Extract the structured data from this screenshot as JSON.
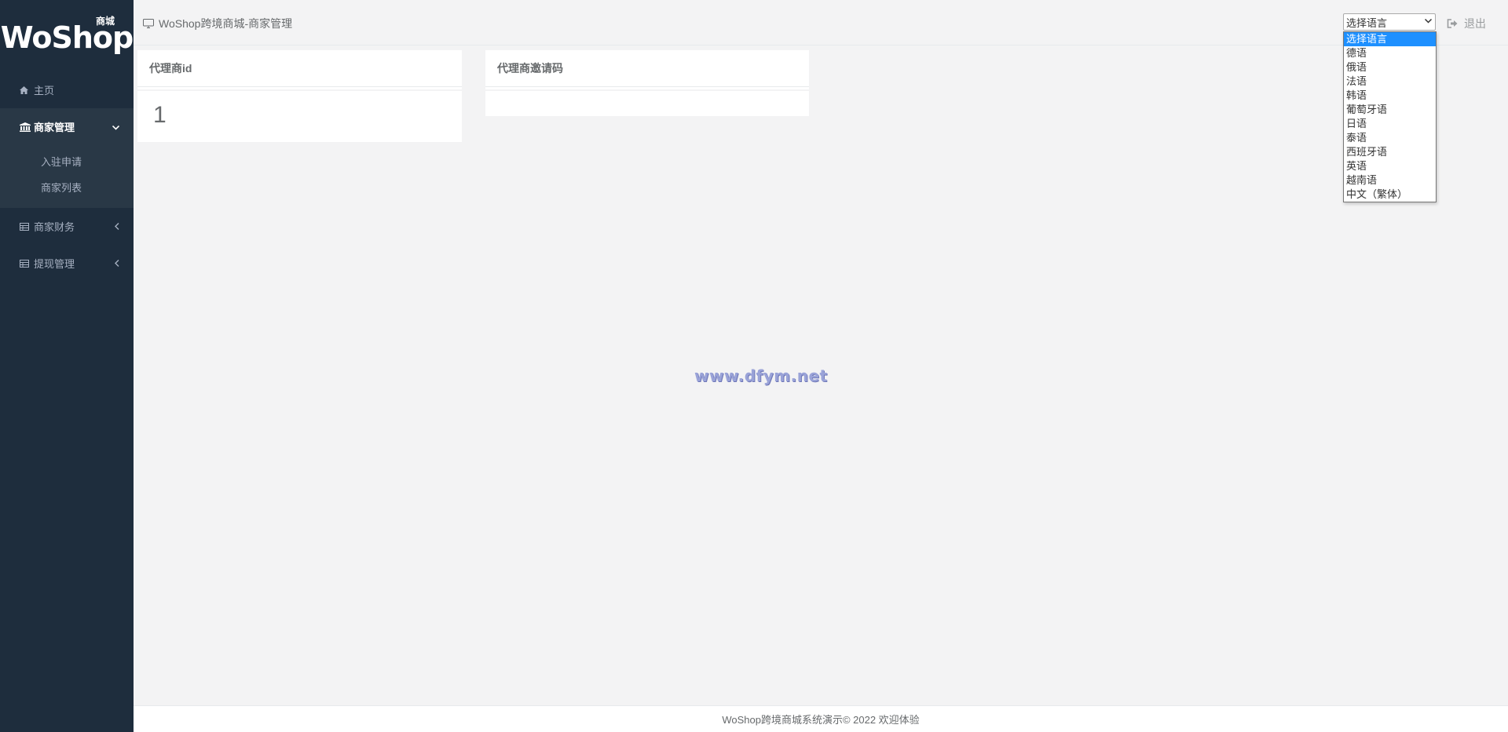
{
  "sidebar": {
    "logo": {
      "text": "WoShop",
      "sub": "商城"
    },
    "home": {
      "label": "主页",
      "icon": "home-icon"
    },
    "merchant": {
      "label": "商家管理",
      "icon": "bank-icon",
      "items": [
        {
          "label": "入驻申请"
        },
        {
          "label": "商家列表"
        }
      ]
    },
    "finance": {
      "label": "商家财务",
      "icon": "table-icon"
    },
    "withdraw": {
      "label": "提现管理",
      "icon": "table-icon"
    }
  },
  "header": {
    "breadcrumb": "WoShop跨境商城-商家管理",
    "language_select": {
      "selected": "选择语言",
      "options": [
        "选择语言",
        "德语",
        "俄语",
        "法语",
        "韩语",
        "葡萄牙语",
        "日语",
        "泰语",
        "西班牙语",
        "英语",
        "越南语",
        "中文（繁体）"
      ]
    },
    "logout_label": "退出"
  },
  "cards": [
    {
      "title": "代理商id",
      "value": "1"
    },
    {
      "title": "代理商邀请码",
      "value": ""
    }
  ],
  "watermark": "www.dfym.net",
  "footer": "WoShop跨境商城系统演示© 2022 欢迎体验",
  "colors": {
    "sidebar_bg": "#1e2d3d",
    "sidebar_active_bg": "#293846",
    "page_bg": "#f3f3f4",
    "dropdown_highlight": "#1e90ff"
  }
}
